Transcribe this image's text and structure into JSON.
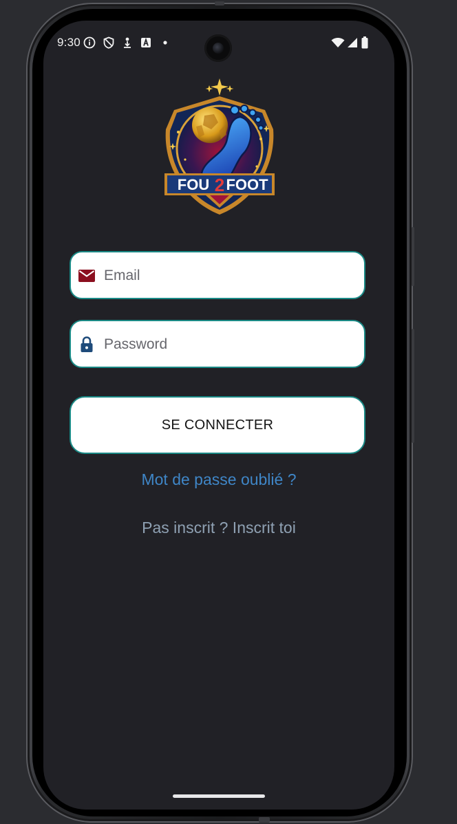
{
  "status_bar": {
    "time": "9:30",
    "icons_left": [
      "info-icon",
      "shield-icon",
      "location-download-icon",
      "font-a-icon",
      "dot-icon"
    ],
    "icons_right": [
      "wifi-icon",
      "signal-icon",
      "battery-icon"
    ]
  },
  "logo": {
    "text_left": "FOU",
    "text_mid": "2",
    "text_right": "FOOT"
  },
  "form": {
    "email_placeholder": "Email",
    "password_placeholder": "Password",
    "email_icon": "mail-icon",
    "password_icon": "lock-icon",
    "submit_label": "SE CONNECTER"
  },
  "links": {
    "forgot_password": "Mot de passe oublié ?",
    "register": "Pas inscrit ? Inscrit toi"
  },
  "colors": {
    "background": "#212126",
    "field_border": "#1a8a86",
    "mail_icon": "#8b0f1f",
    "lock_icon": "#1e4b7a",
    "forgot_link": "#3f86c7",
    "register_link": "#8fa1b3"
  }
}
